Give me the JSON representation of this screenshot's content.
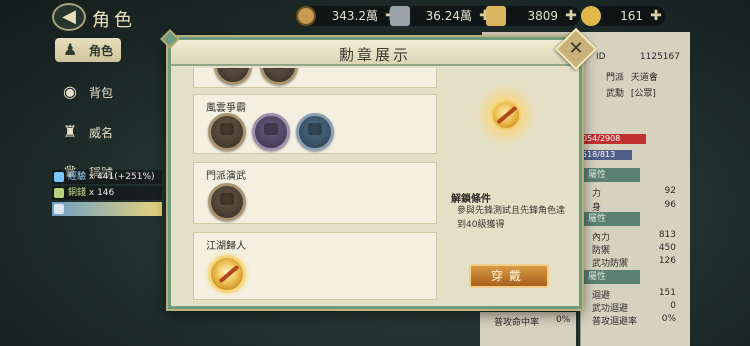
{
  "window": {
    "title": "角色"
  },
  "resources": [
    {
      "name": "coin",
      "value": "343.2萬",
      "color": "#c89a52"
    },
    {
      "name": "silver",
      "value": "36.24萬",
      "color": "#9aa3ab"
    },
    {
      "name": "tael",
      "value": "3809",
      "color": "#d8b860"
    },
    {
      "name": "ingot",
      "value": "161",
      "color": "#e0b84a"
    }
  ],
  "tabs": [
    {
      "label": "角色",
      "icon": "character-icon",
      "active": true
    },
    {
      "label": "背包",
      "icon": "bag-icon",
      "active": false
    },
    {
      "label": "威名",
      "icon": "prestige-icon",
      "active": false
    },
    {
      "label": "稱號",
      "icon": "title-icon",
      "active": false
    }
  ],
  "rewards": [
    {
      "label": "經驗",
      "value": "x 441(+251%)",
      "color": "#7cc6ff"
    },
    {
      "label": "銅錢",
      "value": "x 146",
      "color": "#b7d27a"
    }
  ],
  "profile": {
    "id_label": "ID",
    "id_value": "1125167",
    "faction_label": "門派",
    "faction_value": "天道會",
    "martial_label": "武勳",
    "martial_value": "[公眾]"
  },
  "bars": [
    {
      "value": "054/2908",
      "color": "#c0312f"
    },
    {
      "value": "518/813",
      "color": "#4f5f88"
    }
  ],
  "stats": {
    "section_label": "屬性",
    "groups": [
      {
        "head": "屬性",
        "rows": [
          {
            "label": "力",
            "value": "92"
          },
          {
            "label": "身",
            "value": "96"
          }
        ]
      },
      {
        "head": "屬性",
        "rows": [
          {
            "label": "內力",
            "value": "813"
          },
          {
            "label": "防禦",
            "value": "450"
          },
          {
            "label": "武功防禦",
            "value": "126"
          }
        ]
      },
      {
        "head": "屬性",
        "rows": [
          {
            "label": "迴避",
            "value": "151"
          },
          {
            "label": "武功迴避",
            "value": "0"
          },
          {
            "label": "普攻迴避率",
            "value": "0%"
          }
        ]
      }
    ],
    "bottom": [
      {
        "label": "普攻命中率",
        "value": "0%"
      }
    ]
  },
  "modal": {
    "title": "勳章展示",
    "categories": [
      {
        "title": "風雲爭霸",
        "medals": [
          "medal-bronze",
          "medal-purple",
          "medal-blue"
        ]
      },
      {
        "title": "門派演武",
        "medals": [
          "medal-bronze"
        ]
      },
      {
        "title": "江湖歸人",
        "medals": [
          "medal-gold"
        ]
      }
    ],
    "detail": {
      "unlock_title": "解鎖條件",
      "unlock_text": "參與先鋒測試且先鋒角色達到40級獲得"
    },
    "equip_label": "穿戴"
  }
}
